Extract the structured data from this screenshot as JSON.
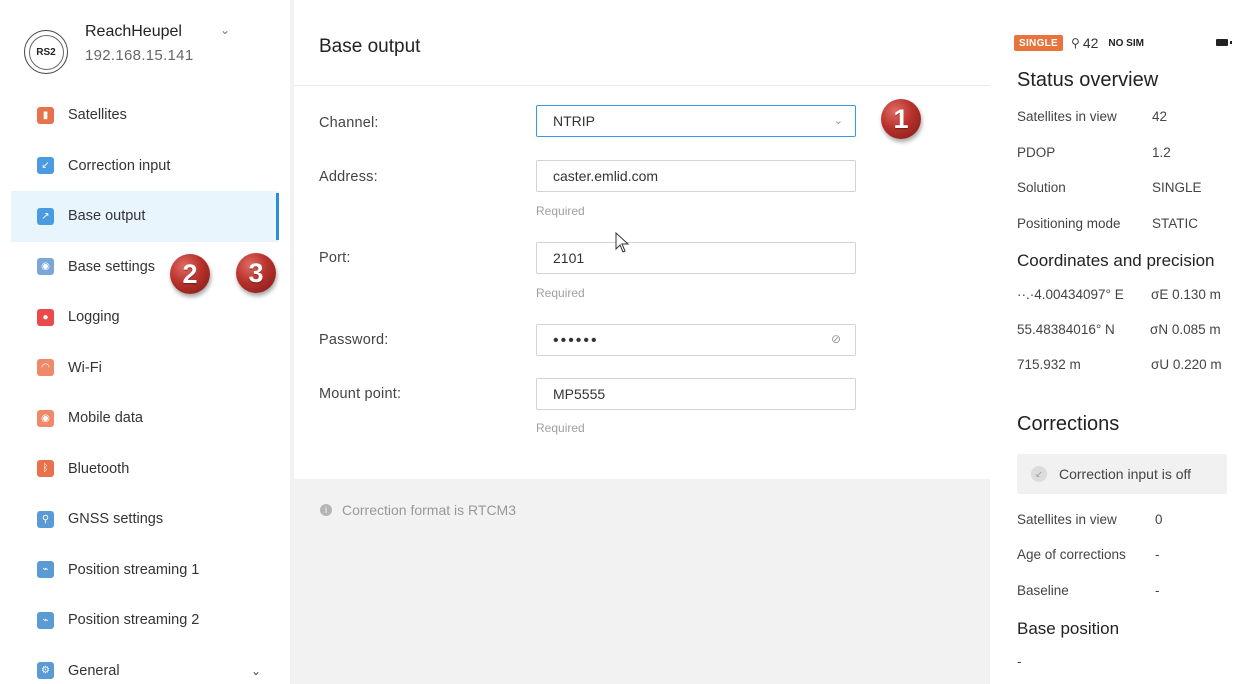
{
  "device": {
    "badge": "RS2",
    "name": "ReachHeupel",
    "ip": "192.168.15.141"
  },
  "sidebar": {
    "items": [
      {
        "label": "Satellites",
        "icon": "satellites-icon",
        "color": "#e8734a",
        "glyph": "▮"
      },
      {
        "label": "Correction input",
        "icon": "correction-input-icon",
        "color": "#4a9be0",
        "glyph": "↙"
      },
      {
        "label": "Base output",
        "icon": "base-output-icon",
        "color": "#4a9be0",
        "glyph": "↗"
      },
      {
        "label": "Base settings",
        "icon": "base-settings-icon",
        "color": "#7aa7d8",
        "glyph": "◉"
      },
      {
        "label": "Logging",
        "icon": "logging-icon",
        "color": "#ea4a4a",
        "glyph": "●"
      },
      {
        "label": "Wi-Fi",
        "icon": "wifi-icon",
        "color": "#ee8a6a",
        "glyph": "◠"
      },
      {
        "label": "Mobile data",
        "icon": "mobile-data-icon",
        "color": "#ee8a6a",
        "glyph": "◉"
      },
      {
        "label": "Bluetooth",
        "icon": "bluetooth-icon",
        "color": "#e8734a",
        "glyph": "ᛒ"
      },
      {
        "label": "GNSS settings",
        "icon": "gnss-settings-icon",
        "color": "#5b9bd5",
        "glyph": "⚲"
      },
      {
        "label": "Position streaming 1",
        "icon": "position-streaming-icon",
        "color": "#5b9bd5",
        "glyph": "⌁"
      },
      {
        "label": "Position streaming 2",
        "icon": "position-streaming-icon",
        "color": "#5b9bd5",
        "glyph": "⌁"
      },
      {
        "label": "General",
        "icon": "general-icon",
        "color": "#5b9bd5",
        "glyph": "⚙"
      }
    ],
    "active_index": 2
  },
  "main": {
    "title": "Base output",
    "channel": {
      "label": "Channel:",
      "value": "NTRIP"
    },
    "address": {
      "label": "Address:",
      "value": "caster.emlid.com",
      "hint": "Required"
    },
    "port": {
      "label": "Port:",
      "value": "2101",
      "hint": "Required"
    },
    "password": {
      "label": "Password:",
      "value": "••••••"
    },
    "mount_point": {
      "label": "Mount point:",
      "value": "MP5555",
      "hint": "Required"
    },
    "note": "Correction format is RTCM3"
  },
  "annotations": [
    "1",
    "2",
    "3"
  ],
  "status": {
    "solution_badge": "SINGLE",
    "sat_count": "42",
    "sim": "NO SIM",
    "overview_title": "Status overview",
    "rows": [
      {
        "key": "Satellites in view",
        "value": "42"
      },
      {
        "key": "PDOP",
        "value": "1.2"
      },
      {
        "key": "Solution",
        "value": "SINGLE"
      },
      {
        "key": "Positioning mode",
        "value": "STATIC"
      }
    ],
    "coords_title": "Coordinates and precision",
    "coords": [
      {
        "value": "··.·4.00434097° E",
        "precision": "σE 0.130 m"
      },
      {
        "value": "55.48384016° N",
        "precision": "σN 0.085 m"
      },
      {
        "value": "715.932 m",
        "precision": "σU 0.220 m"
      }
    ],
    "corrections_title": "Corrections",
    "correction_off": "Correction input is off",
    "corr_rows": [
      {
        "key": "Satellites in view",
        "value": "0"
      },
      {
        "key": "Age of corrections",
        "value": "-"
      },
      {
        "key": "Baseline",
        "value": "-"
      }
    ],
    "base_position_title": "Base position",
    "base_position_value": "-"
  }
}
